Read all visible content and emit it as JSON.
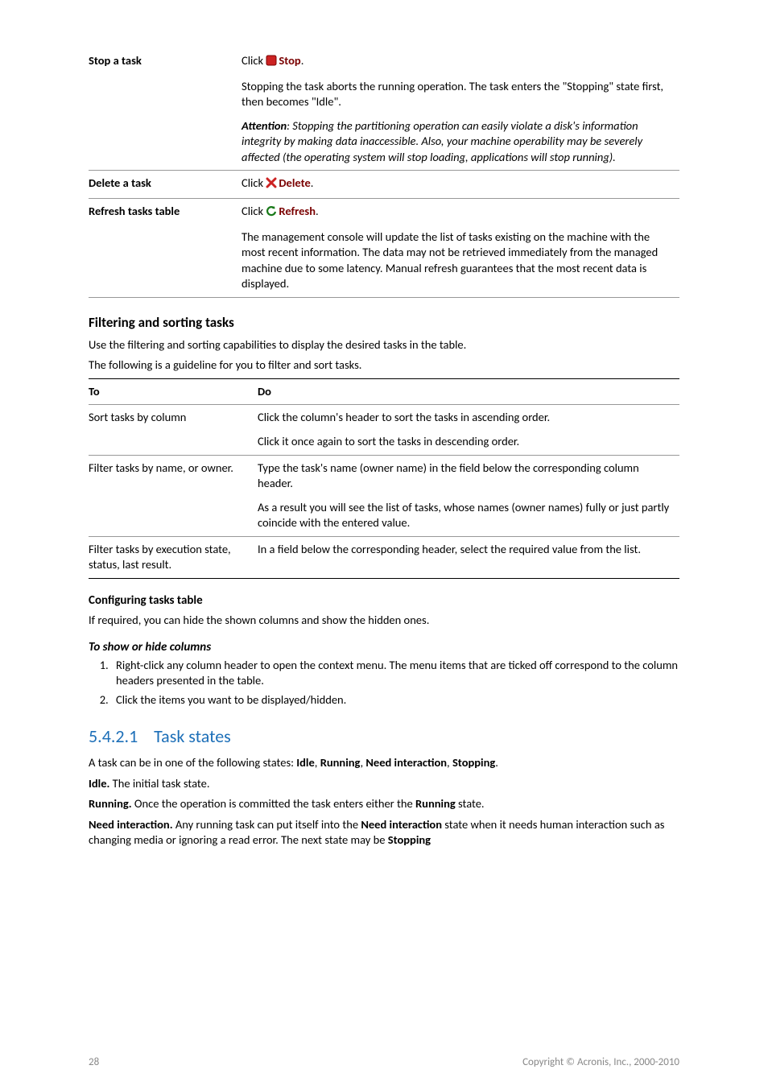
{
  "ops_table": {
    "stop": {
      "label": "Stop a task",
      "click_prefix": "Click ",
      "stop_word": "Stop",
      "period": ".",
      "para1": "Stopping the task aborts the running operation. The task enters the \"Stopping\" state first, then becomes \"Idle\".",
      "attention_label": "Attention",
      "attention_rest": ": Stopping the partitioning operation can easily violate a disk's information integrity by making data inaccessible. Also, your machine operability may be severely affected (the operating system will stop loading, applications will stop running)."
    },
    "delete": {
      "label": "Delete a task",
      "click_prefix": "Click ",
      "delete_word": "Delete",
      "period": "."
    },
    "refresh": {
      "label": "Refresh tasks table",
      "click_prefix": "Click ",
      "refresh_word": "Refresh",
      "period": ".",
      "para1": "The management console will update the list of tasks existing on the machine with the most recent information. The data may not be retrieved immediately from the managed machine due to some latency. Manual refresh guarantees that the most recent data is displayed."
    }
  },
  "filtering": {
    "heading": "Filtering and sorting tasks",
    "intro": "Use the filtering and sorting capabilities to display the desired tasks in the table.",
    "guideline": "The following is a guideline for you to filter and sort tasks.",
    "th_to": "To",
    "th_do": "Do",
    "rows": [
      {
        "to": "Sort tasks by column",
        "do_a": "Click the column's header to sort the tasks in ascending order.",
        "do_b": "Click it once again to sort the tasks in descending order."
      },
      {
        "to": "Filter tasks by name, or owner.",
        "do_a": "Type the task's name (owner name) in the field below the corresponding column header.",
        "do_b": "As a result you will see the list of tasks, whose names (owner names) fully or just partly coincide with the entered value."
      },
      {
        "to": "Filter tasks by execution state, status, last result.",
        "do_a": "In a field below the corresponding header, select the required value from the list."
      }
    ]
  },
  "config": {
    "heading": "Configuring tasks table",
    "intro": "If required, you can hide the shown columns and show the hidden ones.",
    "sub_heading": "To show or hide columns",
    "steps": [
      "Right-click any column header to open the context menu. The menu items that are ticked off correspond to the column headers presented in the table.",
      "Click the items you want to be displayed/hidden."
    ]
  },
  "task_states": {
    "number": "5.4.2.1",
    "title": "Task states",
    "intro_a": "A task can be in one of the following states: ",
    "s1": "Idle",
    "c1": ", ",
    "s2": "Running",
    "c2": ", ",
    "s3": "Need interaction",
    "c3": ", ",
    "s4": "Stopping",
    "period": ".",
    "idle_label": "Idle.",
    "idle_text": " The initial task state.",
    "running_label": "Running.",
    "running_text_a": " Once the operation is committed the task enters either the ",
    "running_text_b": "Running",
    "running_text_c": " state.",
    "need_label": "Need interaction.",
    "need_text_a": " Any running task can put itself into the ",
    "need_text_b": "Need interaction",
    "need_text_c": " state when it needs human interaction such as changing media or ignoring a read error. The next state may be ",
    "need_text_d": "Stopping"
  },
  "footer": {
    "page": "28",
    "copyright": "Copyright © Acronis, Inc., 2000-2010"
  }
}
